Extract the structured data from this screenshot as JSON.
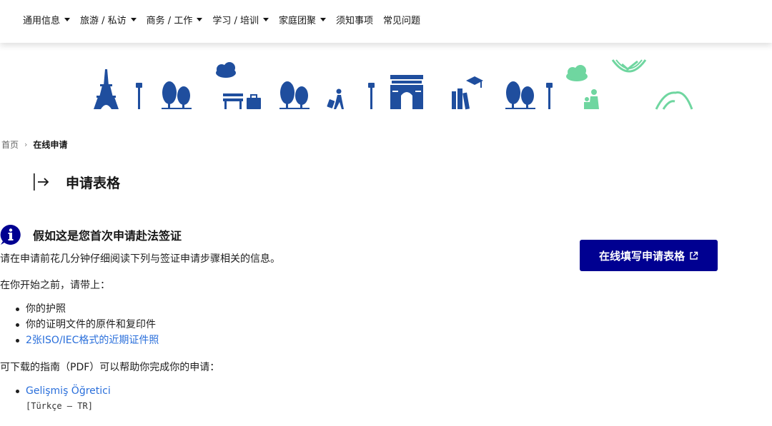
{
  "nav": {
    "items": [
      {
        "label": "通用信息",
        "dropdown": true
      },
      {
        "label": "旅游 / 私访",
        "dropdown": true
      },
      {
        "label": "商务 / 工作",
        "dropdown": true
      },
      {
        "label": "学习 / 培训",
        "dropdown": true
      },
      {
        "label": "家庭团聚",
        "dropdown": true
      },
      {
        "label": "须知事项",
        "dropdown": false
      },
      {
        "label": "常见问题",
        "dropdown": false
      }
    ]
  },
  "breadcrumb": {
    "home": "首页",
    "current": "在线申请"
  },
  "section": {
    "title": "申请表格"
  },
  "info": {
    "title": "假如这是您首次申请赴法签证",
    "intro": "请在申请前花几分钟仔细阅读下列与签证申请步骤相关的信息。",
    "before_start": "在你开始之前，请带上：",
    "items": [
      {
        "text": "你的护照",
        "link": false
      },
      {
        "text": "你的证明文件的原件和复印件",
        "link": false
      },
      {
        "text": "2张ISO/IEC格式的近期证件照",
        "link": true
      }
    ],
    "guide_text": "可下载的指南（PDF）可以帮助你完成你的申请：",
    "guides": [
      {
        "title": "Gelişmiş Öğretici",
        "lang": "[Türkçe – TR]"
      }
    ]
  },
  "cta": {
    "label": "在线填写申请表格"
  },
  "colors": {
    "brand_blue": "#000091",
    "illustration_blue": "#1f4e9e",
    "illustration_green": "#6fd6a0",
    "link": "#2a6fdb"
  }
}
